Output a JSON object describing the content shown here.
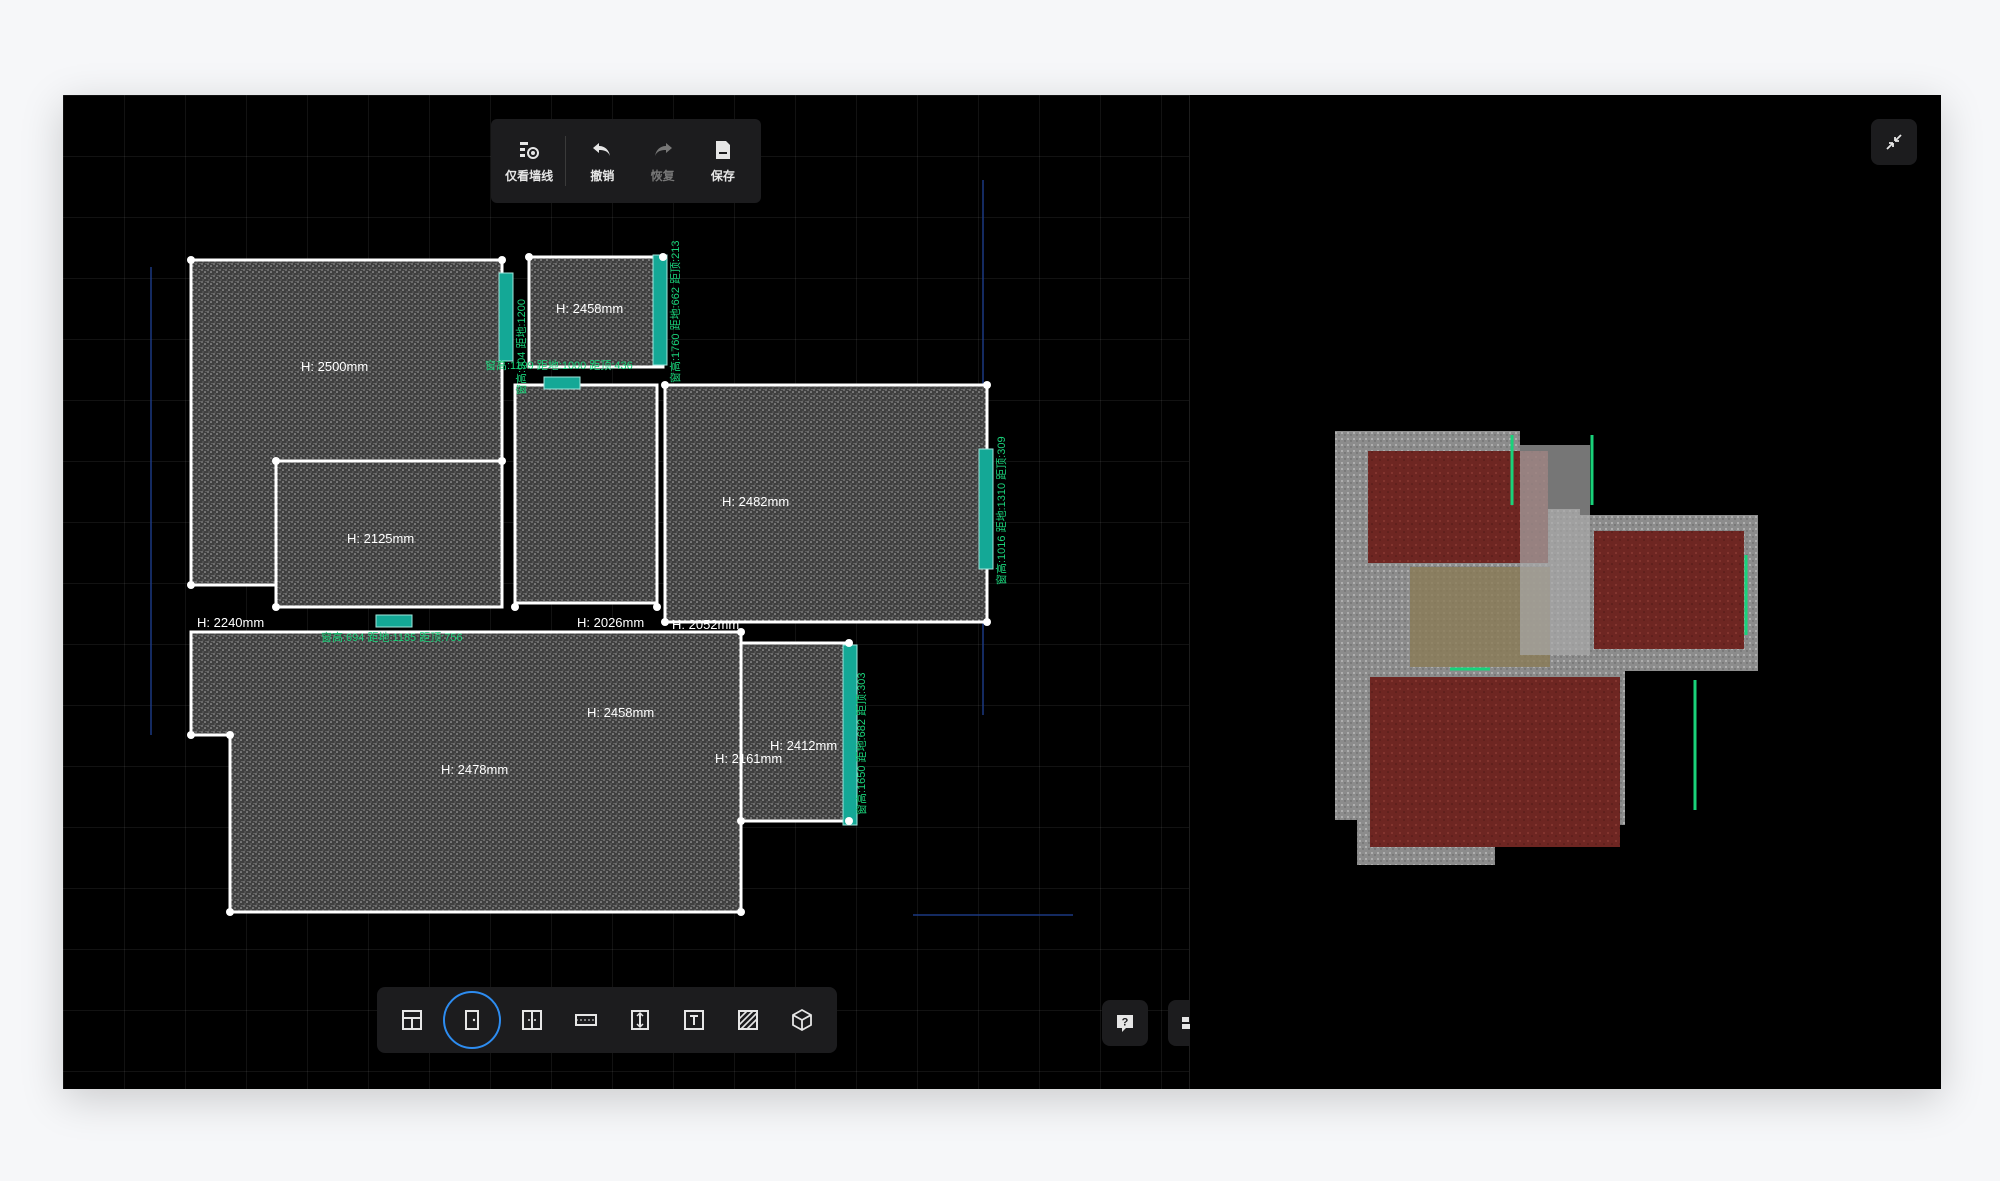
{
  "toolbar": {
    "wall_only_label": "仅看墙线",
    "undo_label": "撤销",
    "redo_label": "恢复",
    "save_label": "保存"
  },
  "heights": {
    "r1": "H: 2500mm",
    "r2": "H: 2458mm",
    "r3": "H: 2482mm",
    "r4": "H: 2125mm",
    "r5": "H: 2240mm",
    "r6": "H: 2026mm",
    "r7": "H: 2052mm",
    "r8": "H: 2458mm",
    "r9": "H: 2478mm",
    "r10": "H: 2412mm",
    "r11": "H: 2161mm"
  },
  "windows": {
    "w1": "窗高:1199 距地:1000 距顶:436",
    "w2": "窗高:904 距地:1200",
    "w3": "窗高:1760 距地:662 距顶:213",
    "w4": "窗高:1016 距地:1310 距顶:309",
    "w5": "窗高:694 距地:1185 距顶:756",
    "w6": "窗高:1650 距地:682 距顶:303"
  },
  "bottom_tools": [
    "room-tool",
    "door-tool",
    "double-door-tool",
    "window-tool",
    "height-tool",
    "text-tool",
    "hatch-tool",
    "3d-tool"
  ],
  "active_tool": "door-tool",
  "colors": {
    "accent": "#2d8cf0",
    "window": "#19d27a",
    "floor": "#7a2a26"
  }
}
